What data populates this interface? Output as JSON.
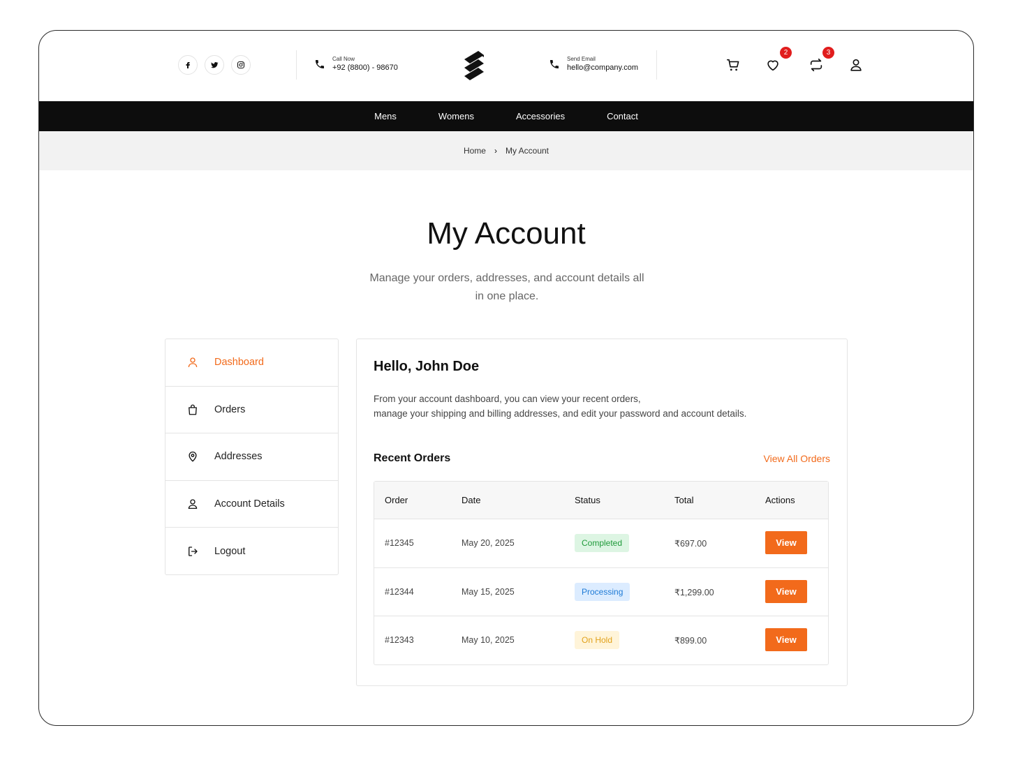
{
  "header": {
    "social": [
      "facebook-icon",
      "twitter-icon",
      "instagram-icon"
    ],
    "call": {
      "label": "Call Now",
      "value": "+92 (8800) - 98670"
    },
    "email": {
      "label": "Send Email",
      "value": "hello@company.com"
    },
    "wishlist_count": "2",
    "compare_count": "3"
  },
  "nav": {
    "items": [
      "Mens",
      "Womens",
      "Accessories",
      "Contact"
    ]
  },
  "breadcrumb": {
    "home": "Home",
    "current": "My Account"
  },
  "page": {
    "title": "My Account",
    "subtitle": "Manage your orders, addresses, and account details all in one place."
  },
  "sidebar": {
    "items": [
      {
        "label": "Dashboard",
        "icon": "user-icon",
        "active": true
      },
      {
        "label": "Orders",
        "icon": "shopping-bag-icon"
      },
      {
        "label": "Addresses",
        "icon": "map-pin-icon"
      },
      {
        "label": "Account Details",
        "icon": "user-icon"
      },
      {
        "label": "Logout",
        "icon": "logout-icon"
      }
    ]
  },
  "dashboard": {
    "greeting": "Hello, John Doe",
    "desc_line1": "From your account dashboard, you can view your recent orders,",
    "desc_line2": "manage your shipping and billing addresses, and edit your password and account details.",
    "recent_title": "Recent Orders",
    "view_all": "View All Orders",
    "columns": [
      "Order",
      "Date",
      "Status",
      "Total",
      "Actions"
    ],
    "orders": [
      {
        "order": "#12345",
        "date": "May 20, 2025",
        "status": "Completed",
        "total": "₹697.00",
        "action": "View"
      },
      {
        "order": "#12344",
        "date": "May 15, 2025",
        "status": "Processing",
        "total": "₹1,299.00",
        "action": "View"
      },
      {
        "order": "#12343",
        "date": "May 10, 2025",
        "status": "On Hold",
        "total": "₹899.00",
        "action": "View"
      }
    ]
  },
  "colors": {
    "accent": "#f26a1b",
    "nav_bg": "#0d0d0d",
    "badge": "#e11d1d"
  }
}
